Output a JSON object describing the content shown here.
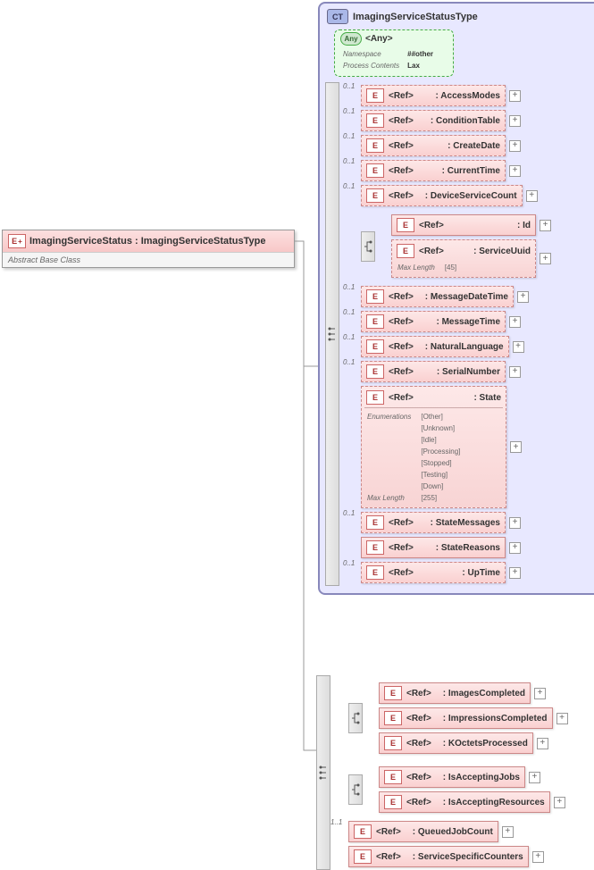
{
  "root": {
    "name": "ImagingServiceStatus : ImagingServiceStatusType",
    "note": "Abstract Base Class",
    "badge": "E"
  },
  "ct": {
    "name": "ImagingServiceStatusType",
    "badge": "CT"
  },
  "any": {
    "label": "<Any>",
    "badge": "Any",
    "rows": [
      [
        "Namespace",
        "##other"
      ],
      [
        "Process Contents",
        "Lax"
      ]
    ]
  },
  "refs": {
    "access": "AccessModes",
    "cond": "ConditionTable",
    "create": "CreateDate",
    "curr": "CurrentTime",
    "devcount": "DeviceServiceCount",
    "id": "Id",
    "uuid": "ServiceUuid",
    "uuid_max": "[45]",
    "mdt": "MessageDateTime",
    "mtime": "MessageTime",
    "lang": "NaturalLanguage",
    "serial": "SerialNumber",
    "state": "State",
    "state_enums": [
      "[Other]",
      "[Unknown]",
      "[Idle]",
      "[Processing]",
      "[Stopped]",
      "[Testing]",
      "[Down]"
    ],
    "state_max": "[255]",
    "smsg": "StateMessages",
    "sreas": "StateReasons",
    "uptime": "UpTime",
    "imgc": "ImagesCompleted",
    "impc": "ImpressionsCompleted",
    "koct": "KOctetsProcessed",
    "accj": "IsAcceptingJobs",
    "accr": "IsAcceptingResources",
    "qjc": "QueuedJobCount",
    "ssc": "ServiceSpecificCounters",
    "label": "<Ref>"
  },
  "occ": {
    "o01": "0..1",
    "o11": "1..1"
  },
  "facet": {
    "enum": "Enumerations",
    "maxlen": "Max Length"
  }
}
